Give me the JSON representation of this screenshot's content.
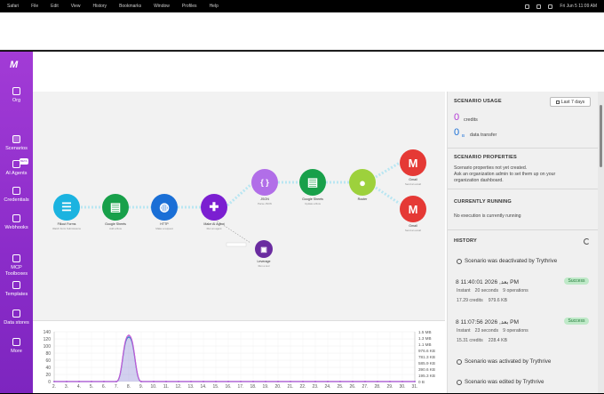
{
  "menubar": {
    "items": [
      "Safari",
      "File",
      "Edit",
      "View",
      "History",
      "Bookmarks",
      "Window",
      "Profiles",
      "Help"
    ],
    "clock": "Fri Jun 5 11:09 AM"
  },
  "sidebar": {
    "logo": "M",
    "items": [
      {
        "label": "Org",
        "icon": "home-icon"
      },
      {
        "label": "Scenarios",
        "icon": "share-icon",
        "active": true
      },
      {
        "label": "AI Agents",
        "icon": "robot-icon",
        "badge": "BETA"
      },
      {
        "label": "Credentials",
        "icon": "shield-icon"
      },
      {
        "label": "Webhooks",
        "icon": "globe-icon"
      },
      {
        "label": "MCP Toolboxes",
        "icon": "toolbox-icon"
      },
      {
        "label": "Templates",
        "icon": "puzzle-icon"
      },
      {
        "label": "Data stores",
        "icon": "database-icon"
      },
      {
        "label": "More",
        "icon": "more-icon"
      }
    ]
  },
  "nodes": [
    {
      "label": "Fillout Forms",
      "sub": "Watch Form Submissions",
      "color": "#1bb3e0",
      "icon": "form-icon"
    },
    {
      "label": "Google Sheets",
      "sub": "Add a Row",
      "color": "#18a04a",
      "icon": "sheet-icon"
    },
    {
      "label": "HTTP",
      "sub": "Make a request",
      "color": "#1a6fd6",
      "icon": "globe-icon"
    },
    {
      "label": "Make AI Agent",
      "sub": "Run an agent",
      "color": "#7b1fd1",
      "icon": "agent-icon"
    },
    {
      "label": "JSON",
      "sub": "Parse JSON",
      "color": "#b16ee8",
      "icon": "json-icon"
    },
    {
      "label": "Google Sheets",
      "sub": "Update a Row",
      "color": "#18a04a",
      "icon": "sheet-icon"
    },
    {
      "label": "Router",
      "sub": "",
      "color": "#9dd13c",
      "icon": "router-icon"
    },
    {
      "label": "Gmail",
      "sub": "Send an email",
      "color": "#e53935",
      "icon": "gmail-icon"
    },
    {
      "label": "Gmail",
      "sub": "Send an email",
      "color": "#e53935",
      "icon": "gmail-icon"
    },
    {
      "label": "Leverage",
      "sub": "Run a tool",
      "color": "#6a2ca0",
      "icon": "tool-icon"
    }
  ],
  "chart_data": {
    "type": "line",
    "x": [
      "2.",
      "3.",
      "4.",
      "5.",
      "6.",
      "7.",
      "8.",
      "9.",
      "10.",
      "11.",
      "12.",
      "13.",
      "14.",
      "15.",
      "16.",
      "17.",
      "18.",
      "19.",
      "20.",
      "21.",
      "22.",
      "23.",
      "24.",
      "25.",
      "26.",
      "27.",
      "28.",
      "29.",
      "30.",
      "31."
    ],
    "yticks_left": [
      "140",
      "120",
      "100",
      "80",
      "60",
      "40",
      "20",
      "0"
    ],
    "yticks_right": [
      "1.5 MB",
      "1.3 MB",
      "1.1 MB",
      "976.6 KB",
      "781.3 KB",
      "585.9 KB",
      "390.6 KB",
      "195.3 KB",
      "0 B"
    ],
    "ylim_left": [
      0,
      140
    ],
    "series": [
      {
        "values": [
          0,
          0,
          0,
          0,
          0,
          0,
          125,
          0,
          0,
          0,
          0,
          0,
          0,
          0,
          0,
          0,
          0,
          0,
          0,
          0,
          0,
          0,
          0,
          0,
          0,
          0,
          0,
          0,
          0,
          0
        ]
      },
      {
        "values": [
          0,
          0,
          0,
          0,
          0,
          0,
          130,
          0,
          0,
          0,
          0,
          0,
          0,
          0,
          0,
          0,
          0,
          0,
          0,
          0,
          0,
          0,
          0,
          0,
          0,
          0,
          0,
          0,
          0,
          0
        ]
      }
    ],
    "colors": [
      "#1a8fc4",
      "#c45ad6"
    ]
  },
  "panel": {
    "usage_title": "SCENARIO USAGE",
    "range_btn": "Last 7 days",
    "credits_value": "0",
    "credits_label": "credits",
    "transfer_value": "0",
    "transfer_unit": "B",
    "transfer_label": "data transfer",
    "props_title": "SCENARIO PROPERTIES",
    "props_text1": "Scenario properties not yet created.",
    "props_text2": "Ask an organization admin to set them up on your",
    "props_text3": "organization dashboard.",
    "running_title": "CURRENTLY RUNNING",
    "running_text": "No execution is currently running",
    "history_title": "HISTORY",
    "history": [
      {
        "type": "event",
        "text": "Scenario was deactivated by Trythrive"
      },
      {
        "type": "run",
        "time": "8 11:40:01 2026 ,بعد PM",
        "status": "Success",
        "mode": "Instant",
        "duration": "20 seconds",
        "ops": "9 operations",
        "credits": "17.29 credits",
        "transfer": "979.6 KB"
      },
      {
        "type": "run",
        "time": "8 11:07:56 2026 ,بعد PM",
        "status": "Success",
        "mode": "Instant",
        "duration": "23 seconds",
        "ops": "9 operations",
        "credits": "15.31 credits",
        "transfer": "228.4 KB"
      },
      {
        "type": "event",
        "text": "Scenario was activated by Trythrive"
      },
      {
        "type": "event",
        "text": "Scenario was edited by Trythrive"
      }
    ]
  }
}
